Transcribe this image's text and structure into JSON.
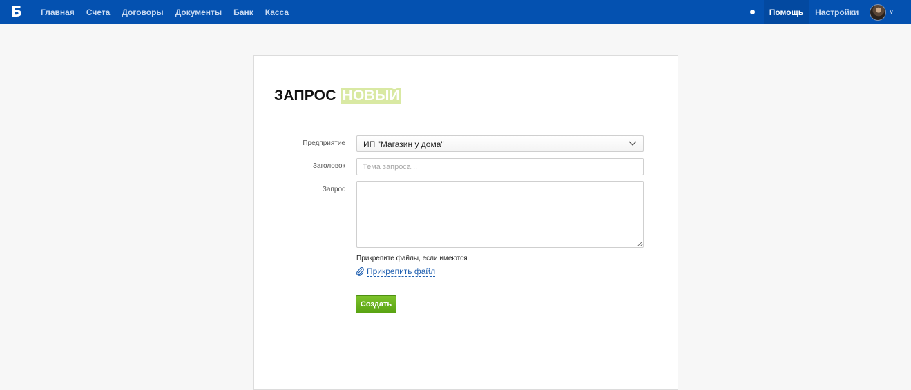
{
  "app": {
    "logo_letter": "Б",
    "brand_color": "#0451b0"
  },
  "nav": {
    "items": [
      {
        "label": "Главная"
      },
      {
        "label": "Счета"
      },
      {
        "label": "Договоры"
      },
      {
        "label": "Документы"
      },
      {
        "label": "Банк"
      },
      {
        "label": "Касса"
      }
    ],
    "help_label": "Помощь",
    "settings_label": "Настройки",
    "status_icon": "status-dot-icon",
    "avatar_icon": "avatar",
    "caret_icon": "chevron-down-icon"
  },
  "form": {
    "title": "ЗАПРОС",
    "status_badge": "НОВЫЙ",
    "enterprise_label": "Предприятие",
    "enterprise_value": "ИП \"Магазин у дома\"",
    "subject_label": "Заголовок",
    "subject_placeholder": "Тема запроса...",
    "subject_value": "",
    "request_label": "Запрос",
    "request_value": "",
    "attach_hint": "Прикрепите файлы, если имеются",
    "attach_link": "Прикрепить файл",
    "create_button": "Создать",
    "colors": {
      "badge_bg": "#d9e9a3",
      "button_green": "#6bb41f",
      "link_blue": "#1f5fb0"
    }
  }
}
